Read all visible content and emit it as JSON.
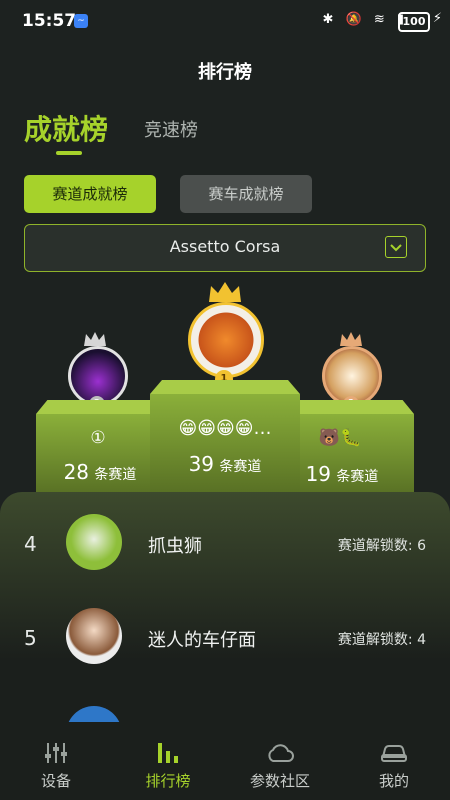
{
  "status_bar": {
    "time": "15:57",
    "battery": "100"
  },
  "header": {
    "title": "排行榜"
  },
  "tabs": {
    "active": "成就榜",
    "inactive": "竞速榜"
  },
  "segments": {
    "active": "赛道成就榜",
    "inactive": "赛车成就榜"
  },
  "game_select": {
    "value": "Assetto Corsa"
  },
  "podium": {
    "first": {
      "rank": "1",
      "name": "😁😁😁😁…",
      "count": "39",
      "unit": "条赛道"
    },
    "second": {
      "rank": "2",
      "name": "①",
      "count": "28",
      "unit": "条赛道"
    },
    "third": {
      "rank": "3",
      "name": "🐻🐛",
      "count": "19",
      "unit": "条赛道"
    }
  },
  "list": [
    {
      "rank": "4",
      "name": "抓虫狮",
      "unlock_label": "赛道解锁数:",
      "unlock_value": "6"
    },
    {
      "rank": "5",
      "name": "迷人的车仔面",
      "unlock_label": "赛道解锁数:",
      "unlock_value": "4"
    }
  ],
  "nav": [
    {
      "label": "设备",
      "icon": "sliders-icon"
    },
    {
      "label": "排行榜",
      "icon": "bar-chart-icon"
    },
    {
      "label": "参数社区",
      "icon": "cloud-icon"
    },
    {
      "label": "我的",
      "icon": "car-icon"
    }
  ],
  "colors": {
    "accent": "#a6d22b",
    "background": "#1d2220",
    "gold": "#f2c230",
    "silver": "#d6d6d6",
    "bronze": "#e6a977"
  }
}
